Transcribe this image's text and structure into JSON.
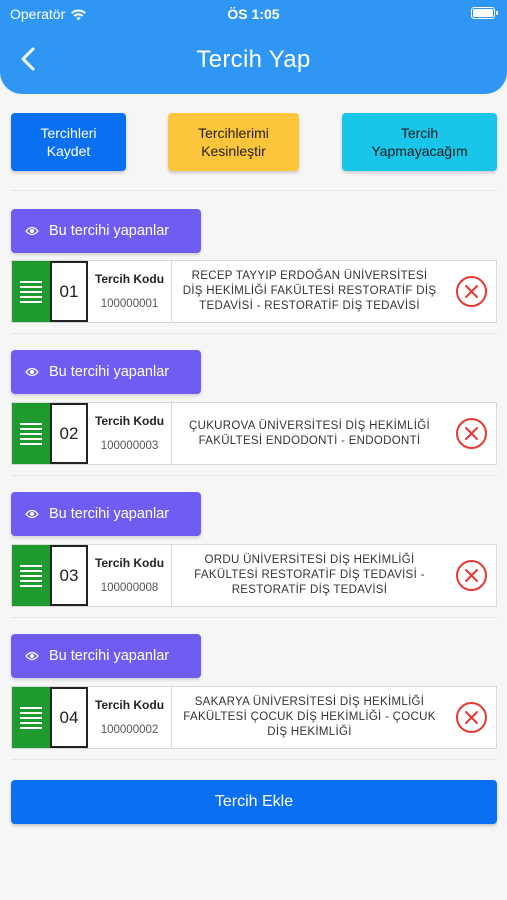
{
  "status_bar": {
    "carrier": "Operatör",
    "time": "ÖS 1:05"
  },
  "header": {
    "title": "Tercih Yap"
  },
  "actions": {
    "save_label": "Tercihleri\nKaydet",
    "finalize_label": "Tercihlerimi\nKesinleştir",
    "no_pref_label": "Tercih\nYapmayacağım"
  },
  "colors": {
    "header": "#2f96f3",
    "primary": "#0b6ff2",
    "warning": "#fdc53b",
    "info": "#19c6ea",
    "purple": "#6f5cf0",
    "handle_green": "#1f9a2e",
    "remove_red": "#e53935"
  },
  "preferences": [
    {
      "viewers_label": "Bu tercihi yapanlar",
      "order": "01",
      "code_label": "Tercih Kodu",
      "code": "100000001",
      "program": "RECEP TAYYIP ERDOĞAN ÜNİVERSİTESİ DİŞ HEKİMLİĞİ FAKÜLTESİ RESTORATİF DİŞ TEDAVİSİ - RESTORATİF DİŞ TEDAVİSİ"
    },
    {
      "viewers_label": "Bu tercihi yapanlar",
      "order": "02",
      "code_label": "Tercih Kodu",
      "code": "100000003",
      "program": "ÇUKUROVA ÜNİVERSİTESİ DİŞ HEKİMLİĞİ FAKÜLTESİ ENDODONTİ - ENDODONTİ"
    },
    {
      "viewers_label": "Bu tercihi yapanlar",
      "order": "03",
      "code_label": "Tercih Kodu",
      "code": "100000008",
      "program": "ORDU ÜNİVERSİTESİ DİŞ HEKİMLİĞİ FAKÜLTESİ RESTORATİF DİŞ TEDAVİSİ - RESTORATİF DİŞ TEDAVİSİ"
    },
    {
      "viewers_label": "Bu tercihi yapanlar",
      "order": "04",
      "code_label": "Tercih Kodu",
      "code": "100000002",
      "program": "SAKARYA ÜNİVERSİTESİ DİŞ HEKİMLİĞİ FAKÜLTESİ ÇOCUK DİŞ HEKİMLİĞİ - ÇOCUK DİŞ HEKİMLİĞİ"
    }
  ],
  "footer": {
    "add_label": "Tercih Ekle"
  }
}
